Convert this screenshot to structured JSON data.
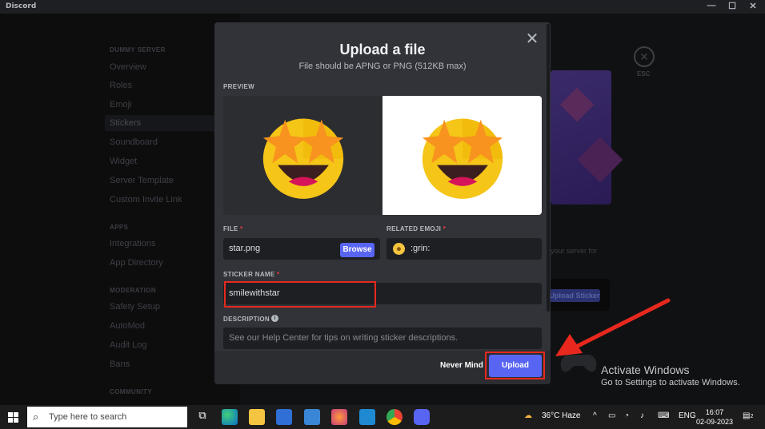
{
  "window": {
    "title": "Discord",
    "controls": [
      "—",
      "☐",
      "✕"
    ]
  },
  "sidebar": {
    "sections": [
      {
        "header": "DUMMY SERVER",
        "items": [
          "Overview",
          "Roles",
          "Emoji",
          "Stickers",
          "Soundboard",
          "Widget",
          "Server Template",
          "Custom Invite Link"
        ]
      },
      {
        "header": "APPS",
        "items": [
          "Integrations",
          "App Directory"
        ]
      },
      {
        "header": "MODERATION",
        "items": [
          "Safety Setup",
          "AutoMod",
          "Audit Log",
          "Bans"
        ]
      },
      {
        "header": "COMMUNITY",
        "items": []
      }
    ],
    "selected": "Stickers"
  },
  "background": {
    "esc_label": "ESC",
    "partial_text": "your server for",
    "partial_button": "Upload Sticker"
  },
  "modal": {
    "title": "Upload a file",
    "subtitle": "File should be APNG or PNG (512KB max)",
    "preview_label": "PREVIEW",
    "file_label": "FILE",
    "file_value": "star.png",
    "browse_label": "Browse",
    "related_emoji_label": "RELATED EMOJI",
    "related_emoji_value": ":grin:",
    "sticker_name_label": "STICKER NAME",
    "sticker_name_value": "smilewithstar",
    "description_label": "DESCRIPTION",
    "description_placeholder": "See our Help Center for tips on writing sticker descriptions.",
    "cancel_label": "Never Mind",
    "upload_label": "Upload"
  },
  "watermark": {
    "line1": "Activate Windows",
    "line2": "Go to Settings to activate Windows."
  },
  "taskbar": {
    "search_placeholder": "Type here to search",
    "weather": "36°C  Haze",
    "language": "ENG",
    "time": "16:07",
    "date": "02-09-2023",
    "notifications": "2"
  },
  "colors": {
    "accent": "#5865f2",
    "highlight": "#e8281e",
    "modal_bg": "#313338"
  }
}
